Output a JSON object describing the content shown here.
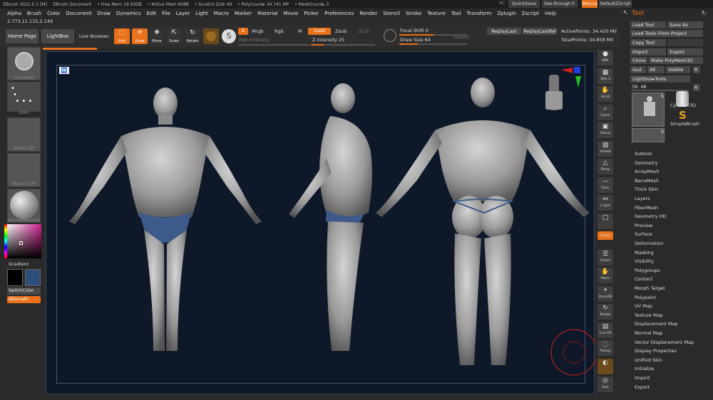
{
  "titlebar": {
    "app": "ZBrush 2022.0.1 [M]",
    "document": "ZBrush Document",
    "free_mem": "• Free Mem 19.93GB",
    "active_mem": "• Active Mem 6088",
    "scratch": "• Scratch Disk 49",
    "polycount": "• PolyCount▸ 34.741 MP",
    "meshcount": "• MeshCount▸ 3",
    "ac": "AC",
    "quicksave": "QuickSave",
    "see_through": "See-through  0",
    "menus": "Menus",
    "default_zscript": "DefaultZScript"
  },
  "menubar": [
    "Alpha",
    "Brush",
    "Color",
    "Document",
    "Draw",
    "Dynamics",
    "Edit",
    "File",
    "Layer",
    "Light",
    "Macro",
    "Marker",
    "Material",
    "Movie",
    "Picker",
    "Preferences",
    "Render",
    "Stencil",
    "Stroke",
    "Texture",
    "Tool",
    "Transform",
    "Zplugin",
    "Zscript",
    "Help"
  ],
  "coordinate_readout": "2.773,11.115,2.149",
  "toolbar": {
    "home_page": "Home Page",
    "lightbox": "LightBox",
    "live_boolean": "Live Boolean",
    "edit": "Edit",
    "draw": "Draw",
    "move": "Move",
    "scale": "Scale",
    "rotate": "Rotate",
    "a": "A",
    "mrgb": "Mrgb",
    "rgb": "Rgb",
    "m": "M",
    "zadd": "Zadd",
    "zsub": "Zsub",
    "zcut": "Zcut",
    "rgb_intensity": "Rgb Intensity",
    "z_intensity": "Z Intensity 25",
    "focal_shift": "Focal Shift 0",
    "draw_size": "Draw Size 64",
    "dynamic": "Dynamic",
    "replay_last": "ReplayLast",
    "replay_last_rel": "ReplayLastRel",
    "active_points": "ActivePoints: 34.420 Mil",
    "total_points": "TotalPoints: 34.858 Mil"
  },
  "left_shelf": {
    "brush": "Standard",
    "stroke": "Dots",
    "alpha": "Alpha Off",
    "texture": "Texture Off",
    "material": "MatcapMaterial",
    "gradient": "Gradient",
    "switch_color": "SwitchColor",
    "alternate": "Alternate",
    "main_color": "#000000",
    "secondary_color": "#2c4e78"
  },
  "right_shelf": [
    {
      "name": "bpr",
      "caption": "BPR"
    },
    {
      "name": "spix",
      "caption": "SPix 3"
    },
    {
      "name": "scroll",
      "caption": "Scroll"
    },
    {
      "name": "zoom",
      "caption": "Zoom"
    },
    {
      "name": "actual",
      "caption": "Actual"
    },
    {
      "name": "aahalf",
      "caption": "AAHalf"
    },
    {
      "name": "persp",
      "caption": "Persp"
    },
    {
      "name": "floor",
      "caption": "Floor"
    },
    {
      "name": "lsym",
      "caption": "L.Sym"
    },
    {
      "name": "local",
      "caption": ""
    },
    {
      "name": "xyz",
      "caption": "Qxyz"
    },
    {
      "name": "frame",
      "caption": "Frame"
    },
    {
      "name": "move",
      "caption": "Move"
    },
    {
      "name": "zoom3d",
      "caption": "Zoom3D"
    },
    {
      "name": "rotate",
      "caption": "Rotate"
    },
    {
      "name": "linefill",
      "caption": "Line Fill"
    },
    {
      "name": "transp",
      "caption": "Transp"
    },
    {
      "name": "ghost",
      "caption": ""
    },
    {
      "name": "solo",
      "caption": "Solo"
    }
  ],
  "tool_panel": {
    "title": "Tool",
    "load_tool": "Load Tool",
    "save_as": "Save As",
    "load_from_project": "Load Tools From Project",
    "copy_tool": "Copy Tool",
    "import": "Import",
    "export": "Export",
    "clone": "Clone",
    "make_polymesh": "Make PolyMesh3D",
    "goz": "GoZ",
    "all": "All",
    "visible": "Visible",
    "r": "R",
    "lightbox_tools": "Lightbox▸Tools",
    "tool_number": "39. 48",
    "tool_count": "5",
    "subtool_count": "5",
    "cylinder": "Cylinder3D",
    "simplebrush": "SimpleBrush",
    "items": [
      "Subtool",
      "Geometry",
      "ArrayMesh",
      "NanoMesh",
      "Thick Skin",
      "Layers",
      "FiberMesh",
      "Geometry HD",
      "Preview",
      "Surface",
      "Deformation",
      "Masking",
      "Visibility",
      "Polygroups",
      "Contact",
      "Morph Target",
      "Polypaint",
      "UV Map",
      "Texture Map",
      "Displacement Map",
      "Normal Map",
      "Vector Displacement Map",
      "Display Properties",
      "Unified Skin",
      "Initialize",
      "Import",
      "Export"
    ]
  },
  "colors": {
    "accent": "#e8711a",
    "viewport_bg": "#0e1828",
    "panel_bg": "#2a2a2a"
  }
}
